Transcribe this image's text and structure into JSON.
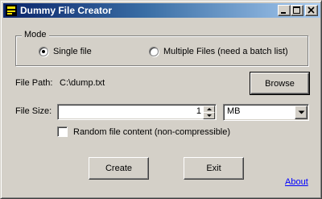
{
  "window": {
    "title": "Dummy File Creator",
    "controls": {
      "minimize": "minimize",
      "maximize": "maximize",
      "close": "close"
    }
  },
  "mode": {
    "group_label": "Mode",
    "options": [
      {
        "label": "Single file",
        "selected": true
      },
      {
        "label": "Multiple Files (need a batch list)",
        "selected": false
      }
    ]
  },
  "file_path": {
    "label": "File Path:",
    "value": "C:\\dump.txt",
    "browse_label": "Browse"
  },
  "file_size": {
    "label": "File Size:",
    "value": "1",
    "unit": "MB"
  },
  "random_content": {
    "label": "Random file content (non-compressible)",
    "checked": false
  },
  "actions": {
    "create_label": "Create",
    "exit_label": "Exit",
    "about_label": "About"
  },
  "colors": {
    "titlebar_start": "#0a246a",
    "titlebar_end": "#a6caf0",
    "face": "#d4d0c8",
    "link": "#0000ff"
  }
}
